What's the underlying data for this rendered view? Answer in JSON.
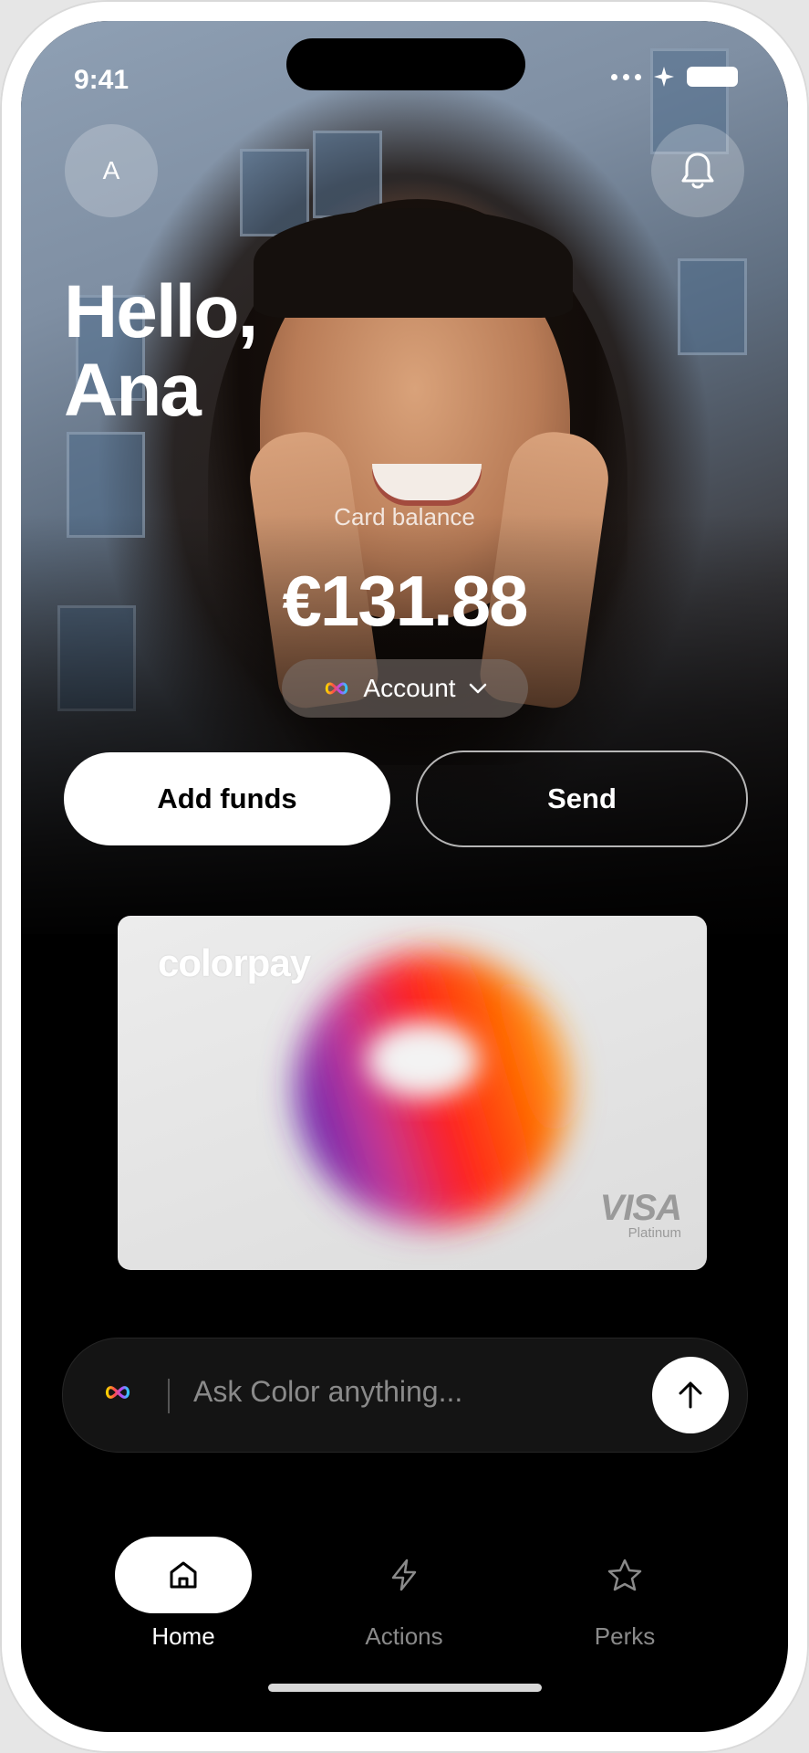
{
  "status_bar": {
    "time": "9:41"
  },
  "header": {
    "avatar_initial": "A"
  },
  "greeting": {
    "line1": "Hello,",
    "line2": "Ana"
  },
  "balance": {
    "label": "Card balance",
    "amount": "€131.88"
  },
  "account_selector": {
    "label": "Account"
  },
  "actions": {
    "add_funds": "Add funds",
    "send": "Send"
  },
  "card": {
    "brand": "colorpay",
    "network": "VISA",
    "tier": "Platinum"
  },
  "ask": {
    "placeholder": "Ask Color anything..."
  },
  "tabs": [
    {
      "label": "Home",
      "icon": "home-icon",
      "active": true
    },
    {
      "label": "Actions",
      "icon": "lightning-icon",
      "active": false
    },
    {
      "label": "Perks",
      "icon": "star-icon",
      "active": false
    }
  ],
  "colors": {
    "active_tab_bg": "#ffffff",
    "inactive_tab": "#8a8a8a",
    "card_gradient": [
      "#6a1fb5",
      "#ff2a2a",
      "#ff8a00"
    ]
  }
}
